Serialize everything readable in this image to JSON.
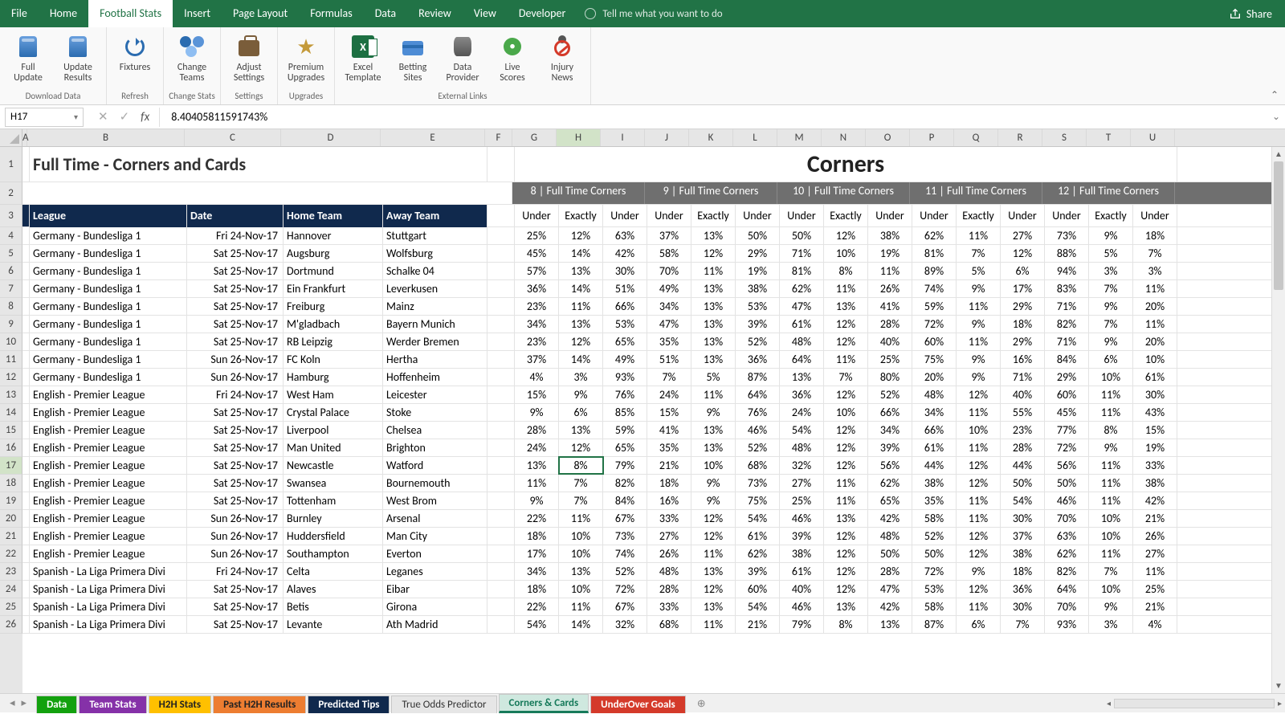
{
  "tabs": [
    "File",
    "Home",
    "Football Stats",
    "Insert",
    "Page Layout",
    "Formulas",
    "Data",
    "Review",
    "View",
    "Developer"
  ],
  "active_tab": 2,
  "tell_me": "Tell me what you want to do",
  "share": "Share",
  "ribbon": {
    "groups": [
      {
        "label": "Download Data",
        "buttons": [
          {
            "key": "full-update",
            "text": "Full\nUpdate",
            "icon": "db"
          },
          {
            "key": "update-results",
            "text": "Update\nResults",
            "icon": "db"
          }
        ]
      },
      {
        "label": "Refresh",
        "buttons": [
          {
            "key": "fixtures",
            "text": "Fixtures",
            "icon": "refresh"
          }
        ]
      },
      {
        "label": "Change Stats",
        "buttons": [
          {
            "key": "change-teams",
            "text": "Change\nTeams",
            "icon": "people"
          }
        ]
      },
      {
        "label": "Settings",
        "buttons": [
          {
            "key": "adjust-settings",
            "text": "Adjust\nSettings",
            "icon": "briefcase"
          }
        ]
      },
      {
        "label": "Upgrades",
        "buttons": [
          {
            "key": "premium-upgrades",
            "text": "Premium\nUpgrades",
            "icon": "star"
          }
        ]
      },
      {
        "label": "External Links",
        "buttons": [
          {
            "key": "excel-template",
            "text": "Excel\nTemplate",
            "icon": "excel"
          },
          {
            "key": "betting-sites",
            "text": "Betting\nSites",
            "icon": "card"
          },
          {
            "key": "data-provider",
            "text": "Data\nProvider",
            "icon": "cylinder"
          },
          {
            "key": "live-scores",
            "text": "Live\nScores",
            "icon": "live"
          },
          {
            "key": "injury-news",
            "text": "Injury\nNews",
            "icon": "injury"
          }
        ]
      }
    ]
  },
  "name_box": "H17",
  "formula": "8.40405811591743%",
  "cols": [
    "A",
    "B",
    "C",
    "D",
    "E",
    "F",
    "G",
    "H",
    "I",
    "J",
    "K",
    "L",
    "M",
    "N",
    "O",
    "P",
    "Q",
    "R",
    "S",
    "T",
    "U"
  ],
  "active_col": "H",
  "active_row": 17,
  "title_left": "Full Time - Corners and Cards",
  "title_right": "Corners",
  "band_headers": [
    "8 | Full Time Corners",
    "9 | Full Time Corners",
    "10 | Full Time Corners",
    "11 | Full Time Corners",
    "12 | Full Time Corners"
  ],
  "navy_headers": [
    "League",
    "Date",
    "Home Team",
    "Away Team"
  ],
  "sub_headers": [
    "Under",
    "Exactly",
    "Under",
    "Under",
    "Exactly",
    "Under",
    "Under",
    "Exactly",
    "Under",
    "Under",
    "Exactly",
    "Under",
    "Under",
    "Exactly",
    "Under"
  ],
  "rows": [
    {
      "n": 4,
      "league": "Germany - Bundesliga 1",
      "date": "Fri 24-Nov-17",
      "home": "Hannover",
      "away": "Stuttgart",
      "v": [
        "25%",
        "12%",
        "63%",
        "37%",
        "13%",
        "50%",
        "50%",
        "12%",
        "38%",
        "62%",
        "11%",
        "27%",
        "73%",
        "9%",
        "18%"
      ]
    },
    {
      "n": 5,
      "league": "Germany - Bundesliga 1",
      "date": "Sat 25-Nov-17",
      "home": "Augsburg",
      "away": "Wolfsburg",
      "v": [
        "45%",
        "14%",
        "42%",
        "58%",
        "12%",
        "29%",
        "71%",
        "10%",
        "19%",
        "81%",
        "7%",
        "12%",
        "88%",
        "5%",
        "7%"
      ]
    },
    {
      "n": 6,
      "league": "Germany - Bundesliga 1",
      "date": "Sat 25-Nov-17",
      "home": "Dortmund",
      "away": "Schalke 04",
      "v": [
        "57%",
        "13%",
        "30%",
        "70%",
        "11%",
        "19%",
        "81%",
        "8%",
        "11%",
        "89%",
        "5%",
        "6%",
        "94%",
        "3%",
        "3%"
      ]
    },
    {
      "n": 7,
      "league": "Germany - Bundesliga 1",
      "date": "Sat 25-Nov-17",
      "home": "Ein Frankfurt",
      "away": "Leverkusen",
      "v": [
        "36%",
        "14%",
        "51%",
        "49%",
        "13%",
        "38%",
        "62%",
        "11%",
        "26%",
        "74%",
        "9%",
        "17%",
        "83%",
        "7%",
        "11%"
      ]
    },
    {
      "n": 8,
      "league": "Germany - Bundesliga 1",
      "date": "Sat 25-Nov-17",
      "home": "Freiburg",
      "away": "Mainz",
      "v": [
        "23%",
        "11%",
        "66%",
        "34%",
        "13%",
        "53%",
        "47%",
        "13%",
        "41%",
        "59%",
        "11%",
        "29%",
        "71%",
        "9%",
        "20%"
      ]
    },
    {
      "n": 9,
      "league": "Germany - Bundesliga 1",
      "date": "Sat 25-Nov-17",
      "home": "M'gladbach",
      "away": "Bayern Munich",
      "v": [
        "34%",
        "13%",
        "53%",
        "47%",
        "13%",
        "39%",
        "61%",
        "12%",
        "28%",
        "72%",
        "9%",
        "18%",
        "82%",
        "7%",
        "11%"
      ]
    },
    {
      "n": 10,
      "league": "Germany - Bundesliga 1",
      "date": "Sat 25-Nov-17",
      "home": "RB Leipzig",
      "away": "Werder Bremen",
      "v": [
        "23%",
        "12%",
        "65%",
        "35%",
        "13%",
        "52%",
        "48%",
        "12%",
        "40%",
        "60%",
        "11%",
        "29%",
        "71%",
        "9%",
        "20%"
      ]
    },
    {
      "n": 11,
      "league": "Germany - Bundesliga 1",
      "date": "Sun 26-Nov-17",
      "home": "FC Koln",
      "away": "Hertha",
      "v": [
        "37%",
        "14%",
        "49%",
        "51%",
        "13%",
        "36%",
        "64%",
        "11%",
        "25%",
        "75%",
        "9%",
        "16%",
        "84%",
        "6%",
        "10%"
      ]
    },
    {
      "n": 12,
      "league": "Germany - Bundesliga 1",
      "date": "Sun 26-Nov-17",
      "home": "Hamburg",
      "away": "Hoffenheim",
      "v": [
        "4%",
        "3%",
        "93%",
        "7%",
        "5%",
        "87%",
        "13%",
        "7%",
        "80%",
        "20%",
        "9%",
        "71%",
        "29%",
        "10%",
        "61%"
      ]
    },
    {
      "n": 13,
      "league": "English - Premier League",
      "date": "Fri 24-Nov-17",
      "home": "West Ham",
      "away": "Leicester",
      "v": [
        "15%",
        "9%",
        "76%",
        "24%",
        "11%",
        "64%",
        "36%",
        "12%",
        "52%",
        "48%",
        "12%",
        "40%",
        "60%",
        "11%",
        "30%"
      ]
    },
    {
      "n": 14,
      "league": "English - Premier League",
      "date": "Sat 25-Nov-17",
      "home": "Crystal Palace",
      "away": "Stoke",
      "v": [
        "9%",
        "6%",
        "85%",
        "15%",
        "9%",
        "76%",
        "24%",
        "10%",
        "66%",
        "34%",
        "11%",
        "55%",
        "45%",
        "11%",
        "43%"
      ]
    },
    {
      "n": 15,
      "league": "English - Premier League",
      "date": "Sat 25-Nov-17",
      "home": "Liverpool",
      "away": "Chelsea",
      "v": [
        "28%",
        "13%",
        "59%",
        "41%",
        "13%",
        "46%",
        "54%",
        "12%",
        "34%",
        "66%",
        "10%",
        "23%",
        "77%",
        "8%",
        "15%"
      ]
    },
    {
      "n": 16,
      "league": "English - Premier League",
      "date": "Sat 25-Nov-17",
      "home": "Man United",
      "away": "Brighton",
      "v": [
        "24%",
        "12%",
        "65%",
        "35%",
        "13%",
        "52%",
        "48%",
        "12%",
        "39%",
        "61%",
        "11%",
        "28%",
        "72%",
        "9%",
        "19%"
      ]
    },
    {
      "n": 17,
      "league": "English - Premier League",
      "date": "Sat 25-Nov-17",
      "home": "Newcastle",
      "away": "Watford",
      "v": [
        "13%",
        "8%",
        "79%",
        "21%",
        "10%",
        "68%",
        "32%",
        "12%",
        "56%",
        "44%",
        "12%",
        "44%",
        "56%",
        "11%",
        "33%"
      ]
    },
    {
      "n": 18,
      "league": "English - Premier League",
      "date": "Sat 25-Nov-17",
      "home": "Swansea",
      "away": "Bournemouth",
      "v": [
        "11%",
        "7%",
        "82%",
        "18%",
        "9%",
        "73%",
        "27%",
        "11%",
        "62%",
        "38%",
        "12%",
        "50%",
        "50%",
        "11%",
        "38%"
      ]
    },
    {
      "n": 19,
      "league": "English - Premier League",
      "date": "Sat 25-Nov-17",
      "home": "Tottenham",
      "away": "West Brom",
      "v": [
        "9%",
        "7%",
        "84%",
        "16%",
        "9%",
        "75%",
        "25%",
        "11%",
        "65%",
        "35%",
        "11%",
        "54%",
        "46%",
        "11%",
        "42%"
      ]
    },
    {
      "n": 20,
      "league": "English - Premier League",
      "date": "Sun 26-Nov-17",
      "home": "Burnley",
      "away": "Arsenal",
      "v": [
        "22%",
        "11%",
        "67%",
        "33%",
        "12%",
        "54%",
        "46%",
        "13%",
        "42%",
        "58%",
        "11%",
        "30%",
        "70%",
        "10%",
        "21%"
      ]
    },
    {
      "n": 21,
      "league": "English - Premier League",
      "date": "Sun 26-Nov-17",
      "home": "Huddersfield",
      "away": "Man City",
      "v": [
        "18%",
        "10%",
        "73%",
        "27%",
        "12%",
        "61%",
        "39%",
        "12%",
        "48%",
        "52%",
        "12%",
        "37%",
        "63%",
        "10%",
        "26%"
      ]
    },
    {
      "n": 22,
      "league": "English - Premier League",
      "date": "Sun 26-Nov-17",
      "home": "Southampton",
      "away": "Everton",
      "v": [
        "17%",
        "10%",
        "74%",
        "26%",
        "11%",
        "62%",
        "38%",
        "12%",
        "50%",
        "50%",
        "12%",
        "38%",
        "62%",
        "11%",
        "27%"
      ]
    },
    {
      "n": 23,
      "league": "Spanish - La Liga Primera Divi",
      "date": "Fri 24-Nov-17",
      "home": "Celta",
      "away": "Leganes",
      "v": [
        "34%",
        "13%",
        "52%",
        "48%",
        "13%",
        "39%",
        "61%",
        "12%",
        "28%",
        "72%",
        "9%",
        "18%",
        "82%",
        "7%",
        "11%"
      ]
    },
    {
      "n": 24,
      "league": "Spanish - La Liga Primera Divi",
      "date": "Sat 25-Nov-17",
      "home": "Alaves",
      "away": "Eibar",
      "v": [
        "18%",
        "10%",
        "72%",
        "28%",
        "12%",
        "60%",
        "40%",
        "12%",
        "47%",
        "53%",
        "12%",
        "36%",
        "64%",
        "10%",
        "25%"
      ]
    },
    {
      "n": 25,
      "league": "Spanish - La Liga Primera Divi",
      "date": "Sat 25-Nov-17",
      "home": "Betis",
      "away": "Girona",
      "v": [
        "22%",
        "11%",
        "67%",
        "33%",
        "13%",
        "54%",
        "46%",
        "13%",
        "42%",
        "58%",
        "11%",
        "30%",
        "70%",
        "9%",
        "21%"
      ]
    },
    {
      "n": 26,
      "league": "Spanish - La Liga Primera Divi",
      "date": "Sat 25-Nov-17",
      "home": "Levante",
      "away": "Ath Madrid",
      "v": [
        "54%",
        "14%",
        "32%",
        "68%",
        "11%",
        "21%",
        "79%",
        "8%",
        "13%",
        "87%",
        "6%",
        "7%",
        "93%",
        "3%",
        "4%"
      ]
    }
  ],
  "sheet_tabs": [
    {
      "label": "Data",
      "cls": "green"
    },
    {
      "label": "Team Stats",
      "cls": "purple"
    },
    {
      "label": "H2H Stats",
      "cls": "yellow"
    },
    {
      "label": "Past H2H Results",
      "cls": "orange"
    },
    {
      "label": "Predicted Tips",
      "cls": "navy"
    },
    {
      "label": "True Odds Predictor",
      "cls": "gray"
    },
    {
      "label": "Corners & Cards",
      "cls": "teal"
    },
    {
      "label": "UnderOver Goals",
      "cls": "red"
    }
  ]
}
